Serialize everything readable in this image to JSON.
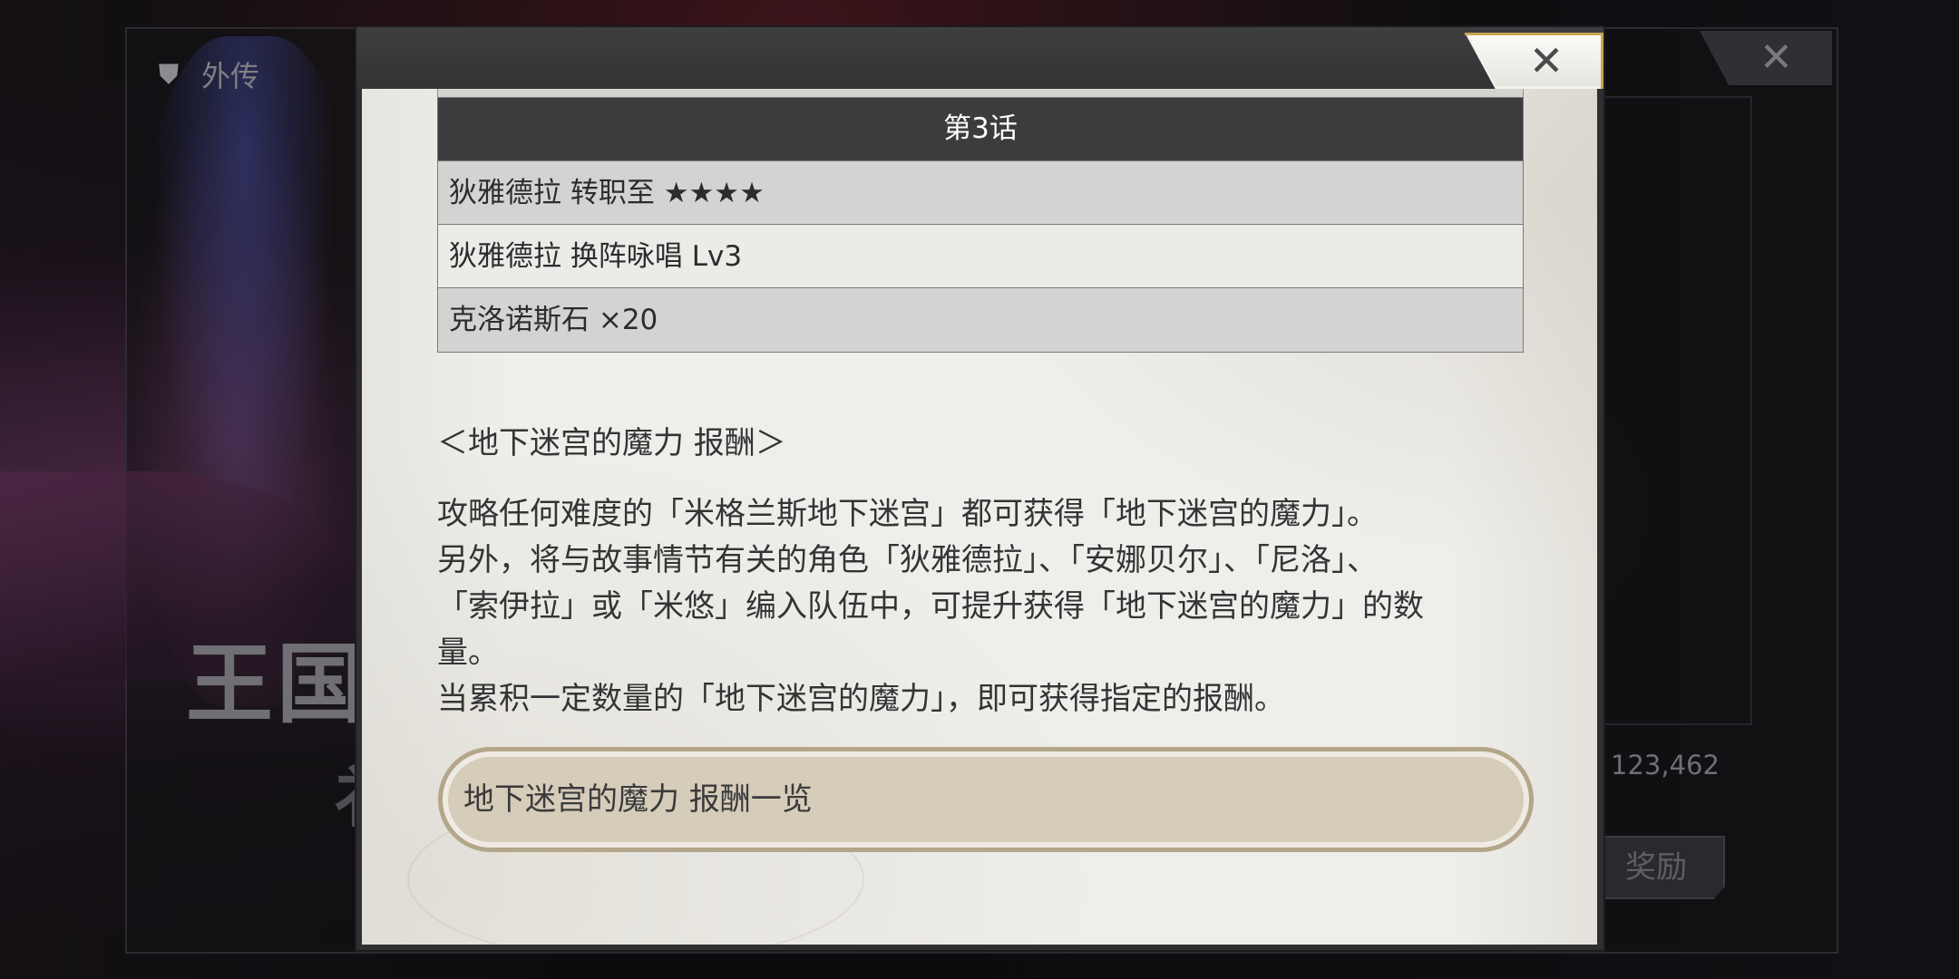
{
  "background": {
    "tab_badge_icon": "shield-icon",
    "tab_label": "外传",
    "title_art": "王国",
    "title_art_line2": "衤",
    "score": "123,462",
    "reward_button_label": "奖励",
    "close_glyph": "✕"
  },
  "modal": {
    "close_glyph": "✕",
    "reward_table": {
      "header": "第3话",
      "rows": [
        "狄雅德拉 转职至 ★★★★",
        "狄雅德拉 换阵咏唱 Lv3",
        "克洛诺斯石 ×20"
      ]
    },
    "section_title": "＜地下迷宫的魔力 报酬＞",
    "description_lines": [
      "攻略任何难度的「米格兰斯地下迷宫」都可获得「地下迷宫的魔力」。",
      "另外，将与故事情节有关的角色「狄雅德拉」、「安娜贝尔」、「尼洛」、",
      "「索伊拉」或「米悠」编入队伍中，可提升获得「地下迷宫的魔力」的数",
      "量。",
      "当累积一定数量的「地下迷宫的魔力」，即可获得指定的报酬。"
    ],
    "list_button_label": "地下迷宫的魔力 报酬一览"
  },
  "colors": {
    "table_header_bg": "#3c3c3e",
    "row_shade": "#d3d3d2",
    "row_light": "#ecebe8",
    "button_fill": "#d5ccb9",
    "button_border": "#b4a68a",
    "close_accent": "#c9a553"
  }
}
